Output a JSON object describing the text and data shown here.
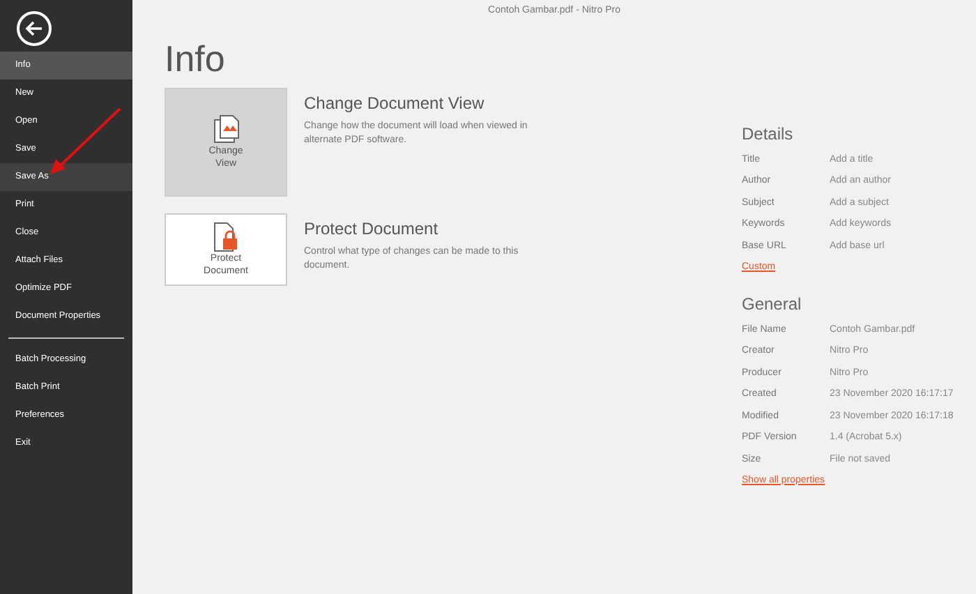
{
  "window": {
    "title": "Contoh Gambar.pdf - Nitro Pro"
  },
  "sidebar": {
    "groups": [
      {
        "items": [
          {
            "label": "Info",
            "selected": true,
            "hovered": false
          },
          {
            "label": "New",
            "selected": false,
            "hovered": false
          },
          {
            "label": "Open",
            "selected": false,
            "hovered": false
          },
          {
            "label": "Save",
            "selected": false,
            "hovered": false
          },
          {
            "label": "Save As",
            "selected": false,
            "hovered": true
          },
          {
            "label": "Print",
            "selected": false,
            "hovered": false
          },
          {
            "label": "Close",
            "selected": false,
            "hovered": false
          },
          {
            "label": "Attach Files",
            "selected": false,
            "hovered": false
          },
          {
            "label": "Optimize PDF",
            "selected": false,
            "hovered": false
          },
          {
            "label": "Document Properties",
            "selected": false,
            "hovered": false
          }
        ]
      },
      {
        "items": [
          {
            "label": "Batch Processing",
            "selected": false,
            "hovered": false
          },
          {
            "label": "Batch Print",
            "selected": false,
            "hovered": false
          },
          {
            "label": "Preferences",
            "selected": false,
            "hovered": false
          },
          {
            "label": "Exit",
            "selected": false,
            "hovered": false
          }
        ]
      }
    ]
  },
  "page_title": "Info",
  "actions": [
    {
      "kind": "view",
      "button": [
        "Change",
        "View"
      ],
      "selected": true,
      "title": "Change Document View",
      "description": "Change how the document will load when viewed in alternate PDF software."
    },
    {
      "kind": "protect",
      "button": [
        "Protect",
        "Document"
      ],
      "selected": false,
      "title": "Protect Document",
      "description": "Control what type of changes can be made to this document."
    }
  ],
  "details": {
    "heading": "Details",
    "rows": [
      {
        "label": "Title",
        "placeholder": "Add a title"
      },
      {
        "label": "Author",
        "placeholder": "Add an author"
      },
      {
        "label": "Subject",
        "placeholder": "Add a subject"
      },
      {
        "label": "Keywords",
        "placeholder": "Add keywords"
      },
      {
        "label": "Base URL",
        "placeholder": "Add base url"
      }
    ],
    "link": "Custom"
  },
  "general": {
    "heading": "General",
    "rows": [
      {
        "label": "File Name",
        "value": "Contoh Gambar.pdf"
      },
      {
        "label": "Creator",
        "value": "Nitro Pro"
      },
      {
        "label": "Producer",
        "value": "Nitro Pro"
      },
      {
        "label": "Created",
        "value": "23 November 2020 16:17:17"
      },
      {
        "label": "Modified",
        "value": "23 November 2020 16:17:18"
      },
      {
        "label": "PDF Version",
        "value": "1.4 (Acrobat 5.x)"
      },
      {
        "label": "Size",
        "value": "File not saved"
      }
    ],
    "link": "Show all properties"
  }
}
